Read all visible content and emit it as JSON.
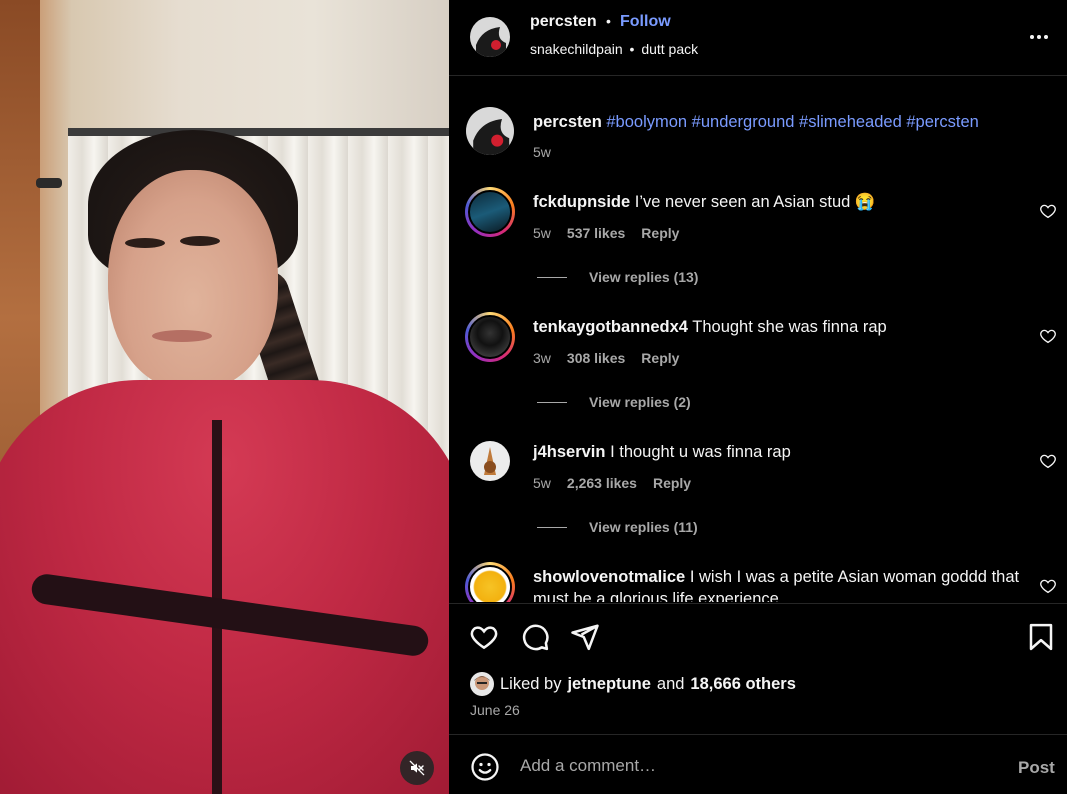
{
  "post": {
    "username": "percsten",
    "follow_label": "Follow",
    "separator": "•",
    "audio_left": "snakechildpain",
    "audio_right": "dutt pack"
  },
  "caption": {
    "username": "percsten",
    "hashtags": "#boolymon #underground #slimeheaded #percsten",
    "time": "5w"
  },
  "comments": [
    {
      "username": "fckdupnside",
      "text": "I’ve never seen an Asian stud 😭",
      "time": "5w",
      "likes": "537 likes",
      "reply_label": "Reply",
      "view_replies": "View replies (13)"
    },
    {
      "username": "tenkaygotbannedx4",
      "text": "Thought she was finna rap",
      "time": "3w",
      "likes": "308 likes",
      "reply_label": "Reply",
      "view_replies": "View replies (2)"
    },
    {
      "username": "j4hservin",
      "text": "I thought u was finna rap",
      "time": "5w",
      "likes": "2,263 likes",
      "reply_label": "Reply",
      "view_replies": "View replies (11)"
    },
    {
      "username": "showlovenotmalice",
      "text": "I wish I was a petite Asian woman goddd that must be a glorious life experience"
    }
  ],
  "likes": {
    "prefix": "Liked by",
    "user": "jetneptune",
    "and": "and",
    "others": "18,666 others"
  },
  "date": "June 26",
  "composer": {
    "placeholder": "Add a comment…",
    "post_label": "Post"
  },
  "colors": {
    "background": "#000000",
    "link": "#7a9bff",
    "secondary_text": "#a8a8a8",
    "divider": "#262626"
  },
  "icons": {
    "header": [
      "more-icon"
    ],
    "actions": [
      "heart-icon",
      "comment-icon",
      "share-icon",
      "bookmark-icon"
    ],
    "media": [
      "muted-speaker-icon"
    ],
    "composer": [
      "emoji-icon"
    ]
  }
}
